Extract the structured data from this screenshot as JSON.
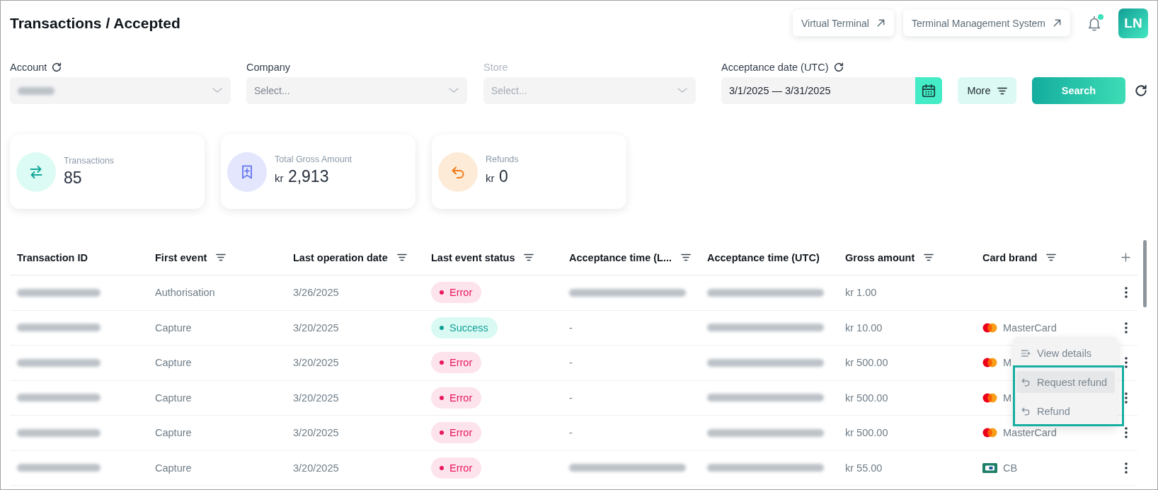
{
  "header": {
    "title": "Transactions / Accepted",
    "links": [
      {
        "label": "Virtual Terminal"
      },
      {
        "label": "Terminal Management System"
      }
    ],
    "notifications": {
      "unread": true
    },
    "avatar": {
      "initials": "LN"
    }
  },
  "filters": [
    {
      "label": "Account",
      "kind": "select",
      "reset_icon": true,
      "disabled": false,
      "blurred_value": true
    },
    {
      "label": "Company",
      "kind": "select",
      "reset_icon": false,
      "disabled": false,
      "blurred_value": false,
      "placeholder": "Select..."
    },
    {
      "label": "Store",
      "kind": "select",
      "reset_icon": false,
      "disabled": true,
      "blurred_value": false,
      "placeholder": "Select..."
    },
    {
      "label": "Acceptance date (UTC)",
      "kind": "date",
      "reset_icon": true,
      "disabled": false,
      "blurred_value": false,
      "value": "3/1/2025 — 3/31/2025"
    }
  ],
  "actions": {
    "more": {
      "label": "More"
    },
    "search": {
      "label": "Search"
    }
  },
  "stats": [
    {
      "kind": "transactions",
      "label": "Transactions",
      "value": "85"
    },
    {
      "kind": "gross",
      "label": "Total Gross Amount",
      "currency": "kr",
      "value": "2,913"
    },
    {
      "kind": "refunds",
      "label": "Refunds",
      "currency": "kr",
      "value": "0"
    }
  ],
  "table": {
    "columns": [
      {
        "label": "Transaction ID",
        "filter": false
      },
      {
        "label": "First event",
        "filter": true
      },
      {
        "label": "Last operation date",
        "filter": true
      },
      {
        "label": "Last event status",
        "filter": true
      },
      {
        "label": "Acceptance time (L...",
        "filter": true
      },
      {
        "label": "Acceptance time (UTC)",
        "filter": false
      },
      {
        "label": "Gross amount",
        "filter": true
      },
      {
        "label": "Card brand",
        "filter": true
      }
    ],
    "rows": [
      {
        "transaction_id": {
          "kind": "blurred"
        },
        "first_event": "Authorisation",
        "last_operation_date": "3/26/2025",
        "status": {
          "label": "Error",
          "kind": "error"
        },
        "acceptance_time_local": {
          "kind": "blurred"
        },
        "acceptance_time_utc": {
          "kind": "blurred"
        },
        "gross_amount": "kr 1.00"
      },
      {
        "transaction_id": {
          "kind": "blurred"
        },
        "first_event": "Capture",
        "last_operation_date": "3/20/2025",
        "status": {
          "label": "Success",
          "kind": "success"
        },
        "acceptance_time_local": {
          "kind": "text",
          "text": "-"
        },
        "acceptance_time_utc": {
          "kind": "blurred"
        },
        "gross_amount": "kr 10.00",
        "card_brand": {
          "kind": "mastercard",
          "name": "MasterCard"
        },
        "menu": {
          "items": [
            {
              "label": "View details",
              "kind": "details",
              "selected": false,
              "framed": false
            },
            {
              "label": "Request refund",
              "kind": "refund",
              "selected": true,
              "framed": true
            },
            {
              "label": "Refund",
              "kind": "refund",
              "selected": false,
              "framed": true
            }
          ]
        }
      },
      {
        "transaction_id": {
          "kind": "blurred"
        },
        "first_event": "Capture",
        "last_operation_date": "3/20/2025",
        "status": {
          "label": "Error",
          "kind": "error"
        },
        "acceptance_time_local": {
          "kind": "text",
          "text": "-"
        },
        "acceptance_time_utc": {
          "kind": "blurred"
        },
        "gross_amount": "kr 500.00",
        "card_brand": {
          "kind": "mastercard",
          "name": "M"
        }
      },
      {
        "transaction_id": {
          "kind": "blurred"
        },
        "first_event": "Capture",
        "last_operation_date": "3/20/2025",
        "status": {
          "label": "Error",
          "kind": "error"
        },
        "acceptance_time_local": {
          "kind": "text",
          "text": "-"
        },
        "acceptance_time_utc": {
          "kind": "blurred"
        },
        "gross_amount": "kr 500.00",
        "card_brand": {
          "kind": "mastercard",
          "name": "M"
        }
      },
      {
        "transaction_id": {
          "kind": "blurred"
        },
        "first_event": "Capture",
        "last_operation_date": "3/20/2025",
        "status": {
          "label": "Error",
          "kind": "error"
        },
        "acceptance_time_local": {
          "kind": "text",
          "text": "-"
        },
        "acceptance_time_utc": {
          "kind": "blurred"
        },
        "gross_amount": "kr 500.00",
        "card_brand": {
          "kind": "mastercard",
          "name": "MasterCard"
        }
      },
      {
        "transaction_id": {
          "kind": "blurred"
        },
        "first_event": "Capture",
        "last_operation_date": "3/20/2025",
        "status": {
          "label": "Error",
          "kind": "error"
        },
        "acceptance_time_local": {
          "kind": "blurred"
        },
        "acceptance_time_utc": {
          "kind": "blurred"
        },
        "gross_amount": "kr 55.00",
        "card_brand": {
          "kind": "cb",
          "name": "CB"
        }
      }
    ]
  }
}
